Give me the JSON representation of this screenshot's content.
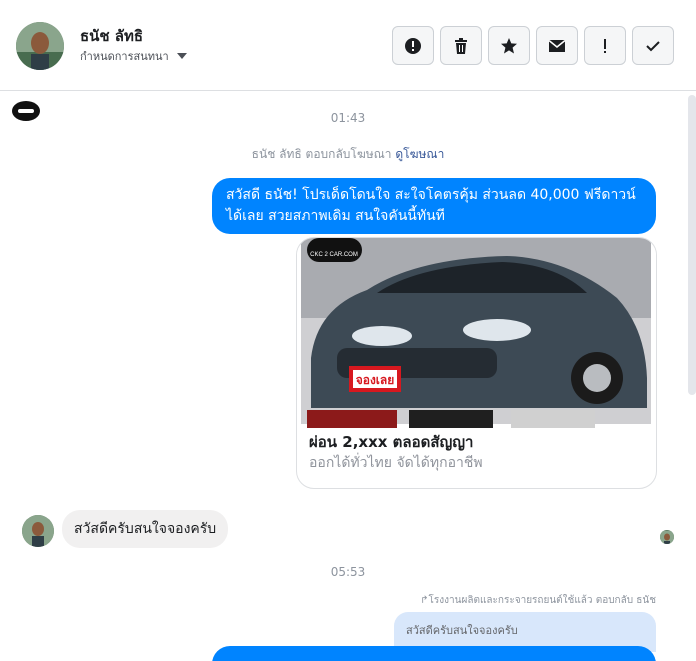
{
  "header": {
    "contact_name": "ธนัช ลัทธิ",
    "assign_label": "กำหนดการสนทนา",
    "actions": [
      {
        "name": "mark-spam-button",
        "icon": "alert-circle-icon"
      },
      {
        "name": "delete-button",
        "icon": "trash-icon"
      },
      {
        "name": "star-button",
        "icon": "star-icon"
      },
      {
        "name": "mark-unread-button",
        "icon": "envelope-icon"
      },
      {
        "name": "follow-up-button",
        "icon": "exclamation-icon"
      },
      {
        "name": "done-button",
        "icon": "checkmark-icon"
      }
    ]
  },
  "thread": {
    "time_1": "01:43",
    "reply_note_text": "ธนัช ลัทธิ ตอบกลับโฆษณา",
    "reply_note_link": "ดูโฆษณา",
    "outgoing_message": "สวัสดี ธนัช! โปรเด็ดโดนใจ สะใจโคตรคุ้ม ส่วนลด 40,000 ฟรีดาวน์ได้เลย สวยสภาพเดิม สนใจคันนี้ทันที",
    "card": {
      "badge_text": "จองเลย",
      "title": "ผ่อน 2,xxx ตลอดสัญญา",
      "subtitle": "ออกได้ทั่วไทย จัดได้ทุกอาชีพ"
    },
    "incoming_message": "สวัสดีครับสนใจจองครับ",
    "time_2": "05:53",
    "replied_to_note": "↱โรงงานผลิตและกระจายรถยนต์ใช้แล้ว ตอบกลับ ธนัช",
    "quoted_text": "สวัสดีครับสนใจจองครับ"
  },
  "colors": {
    "accent": "#0084ff",
    "link": "#385898",
    "bubble_in": "#f1f0f0"
  }
}
